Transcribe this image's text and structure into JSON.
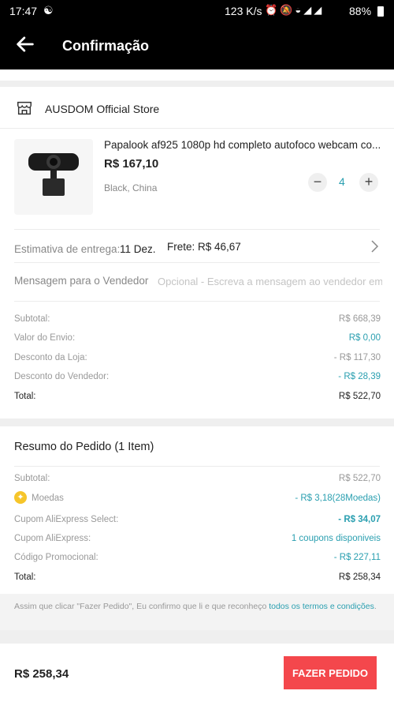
{
  "status_bar": {
    "time": "17:47",
    "network_speed": "123 K/s",
    "battery": "88%",
    "icons": [
      "notification-icon",
      "alarm-icon",
      "mute-icon",
      "wifi-icon",
      "signal-icon",
      "battery-icon"
    ]
  },
  "app_bar": {
    "title": "Confirmação",
    "back_icon": "arrow-left-icon"
  },
  "store": {
    "name": "AUSDOM Official Store",
    "icon": "store-icon"
  },
  "product": {
    "title": "Papalook af925 1080p hd completo autofoco webcam co...",
    "price": "R$ 167,10",
    "variant": "Black, China",
    "quantity": "4",
    "minus": "−",
    "plus": "+"
  },
  "delivery": {
    "label": "Estimativa de entrega:",
    "date": "11 Dez.",
    "shipping": "Frete: R$ 46,67"
  },
  "message": {
    "label": "Mensagem para o Vendedor",
    "placeholder": "Opcional - Escreva a mensagem ao vendedor em"
  },
  "store_summary": [
    {
      "label": "Subtotal:",
      "value": "R$ 668,39"
    },
    {
      "label": "Valor do Envio:",
      "value": "R$ 0,00"
    },
    {
      "label": "Desconto da Loja:",
      "value": "- R$ 117,30"
    },
    {
      "label": "Desconto do Vendedor:",
      "value": "- R$ 28,39"
    },
    {
      "label": "Total:",
      "value": "R$ 522,70"
    }
  ],
  "order_summary": {
    "title": "Resumo do Pedido (1 Item)",
    "rows": [
      {
        "label": "Subtotal:",
        "value": "R$ 522,70"
      },
      {
        "label": "Moedas",
        "value": "- R$ 3,18(28Moedas)"
      },
      {
        "label": "Cupom AliExpress Select:",
        "value": "- R$ 34,07"
      },
      {
        "label": "Cupom AliExpress:",
        "value": "1 coupons disponiveis"
      },
      {
        "label": "Código Promocional:",
        "value": "- R$ 227,11"
      },
      {
        "label": "Total:",
        "value": "R$ 258,34"
      }
    ]
  },
  "terms": {
    "text": "Assim que clicar \"Fazer Pedido\", Eu confirmo que li e que reconheço ",
    "link": "todos os termos e condições",
    "end": "."
  },
  "footer": {
    "total": "R$ 258,34",
    "button": "FAZER PEDIDO"
  },
  "colors": {
    "accent_blue": "#2a9fb0",
    "order_button": "#f4474c",
    "coin": "#f6c52a"
  }
}
